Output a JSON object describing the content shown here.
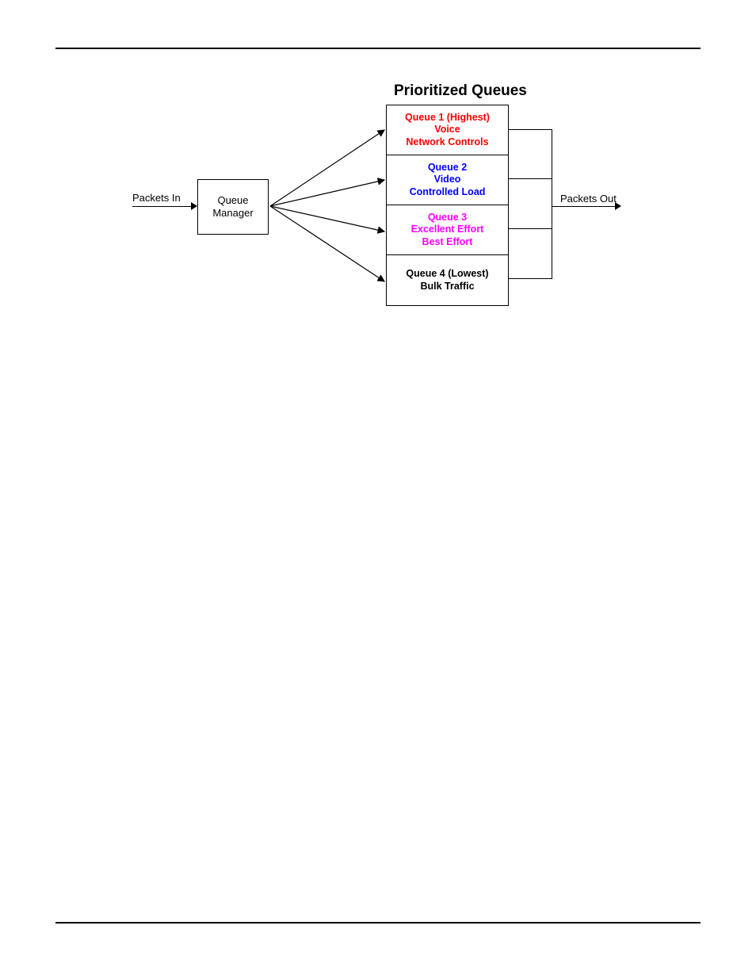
{
  "figure": {
    "title": "Prioritized Queues",
    "packets_in": "Packets In",
    "packets_out": "Packets Out",
    "queue_manager_l1": "Queue",
    "queue_manager_l2": "Manager",
    "queues": [
      {
        "l1": "Queue 1 (Highest)",
        "l2": "Voice",
        "l3": "Network Controls"
      },
      {
        "l1": "Queue 2",
        "l2": "Video",
        "l3": "Controlled Load"
      },
      {
        "l1": "Queue 3",
        "l2": "Excellent Effort",
        "l3": "Best Effort"
      },
      {
        "l1": "Queue 4 (Lowest)",
        "l2": "Bulk Traffic",
        "l3": ""
      }
    ]
  }
}
